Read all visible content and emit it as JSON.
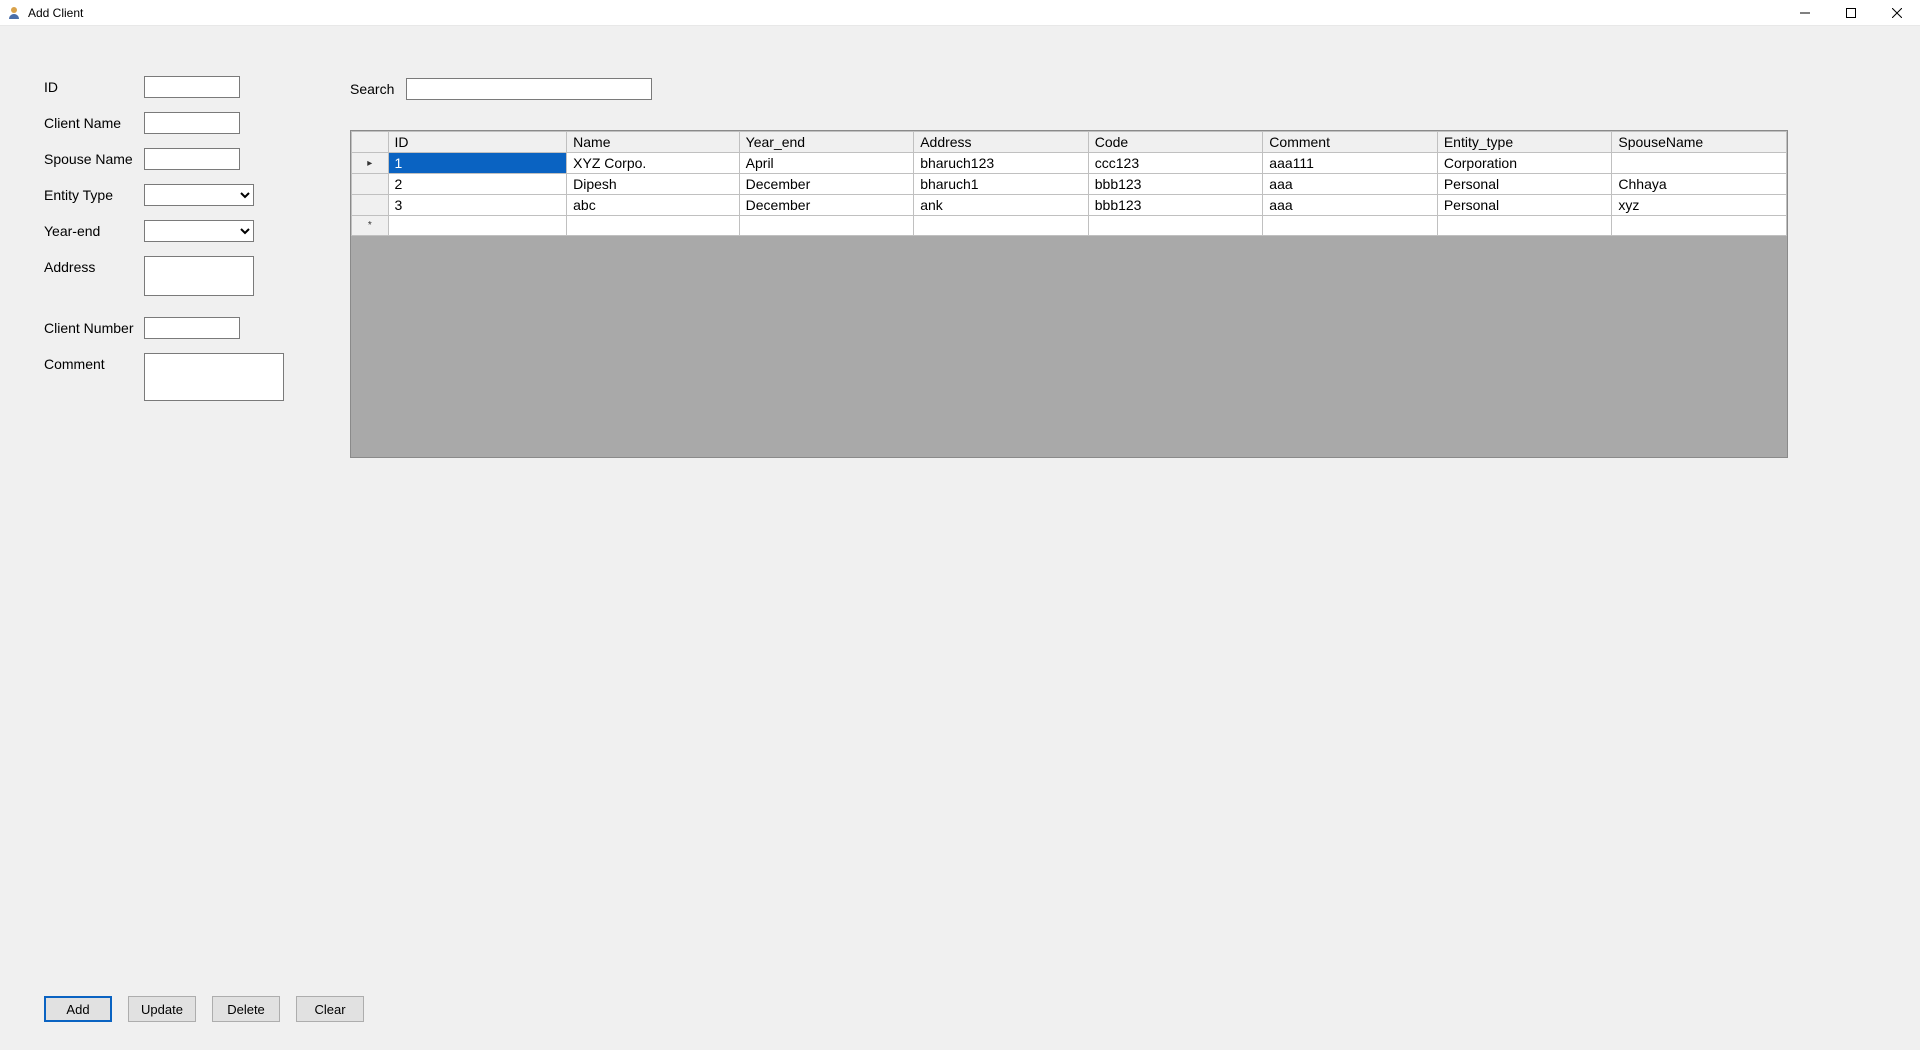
{
  "window": {
    "title": "Add Client"
  },
  "form": {
    "labels": {
      "id": "ID",
      "client_name": "Client Name",
      "spouse_name": "Spouse Name",
      "entity_type": "Entity Type",
      "year_end": "Year-end",
      "address": "Address",
      "client_number": "Client Number",
      "comment": "Comment"
    },
    "values": {
      "id": "",
      "client_name": "",
      "spouse_name": "",
      "entity_type": "",
      "year_end": "",
      "address": "",
      "client_number": "",
      "comment": ""
    }
  },
  "search": {
    "label": "Search",
    "value": ""
  },
  "grid": {
    "headers": {
      "id": "ID",
      "name": "Name",
      "year_end": "Year_end",
      "address": "Address",
      "code": "Code",
      "comment": "Comment",
      "entity_type": "Entity_type",
      "spouse_name": "SpouseName"
    },
    "rows": [
      {
        "id": "1",
        "name": "XYZ Corpo.",
        "year_end": "April",
        "address": "bharuch123",
        "code": "ccc123",
        "comment": "aaa111",
        "entity_type": "Corporation",
        "spouse_name": ""
      },
      {
        "id": "2",
        "name": "Dipesh",
        "year_end": "December",
        "address": "bharuch1",
        "code": "bbb123",
        "comment": "aaa",
        "entity_type": "Personal",
        "spouse_name": "Chhaya"
      },
      {
        "id": "3",
        "name": "abc",
        "year_end": "December",
        "address": "ank",
        "code": "bbb123",
        "comment": "aaa",
        "entity_type": "Personal",
        "spouse_name": "xyz"
      }
    ],
    "row_markers": {
      "current": "▸",
      "new": "*"
    }
  },
  "buttons": {
    "add": "Add",
    "update": "Update",
    "delete": "Delete",
    "clear": "Clear"
  }
}
